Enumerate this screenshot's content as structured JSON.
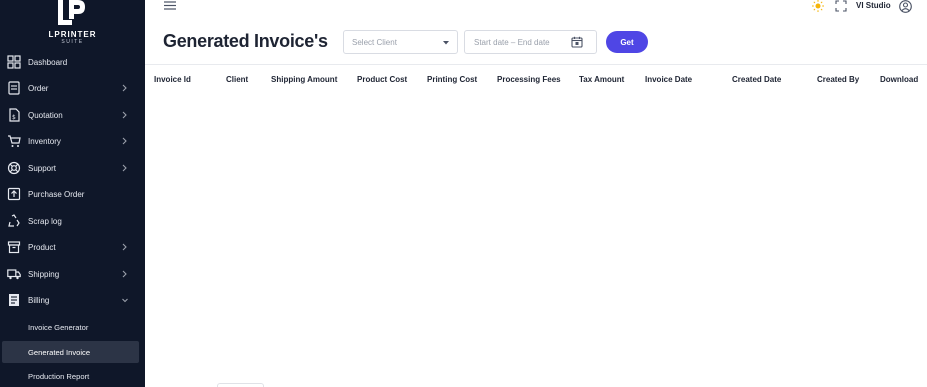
{
  "brand": {
    "title": "LPRINTER",
    "subtitle": "SUITE"
  },
  "sidebar": {
    "items": [
      {
        "label": "Dashboard",
        "icon": "dashboard-icon",
        "has_chevron": false
      },
      {
        "label": "Order",
        "icon": "order-icon",
        "has_chevron": true
      },
      {
        "label": "Quotation",
        "icon": "quotation-icon",
        "has_chevron": true
      },
      {
        "label": "Inventory",
        "icon": "cart-icon",
        "has_chevron": true
      },
      {
        "label": "Support",
        "icon": "support-icon",
        "has_chevron": true
      },
      {
        "label": "Purchase Order",
        "icon": "purchase-order-icon",
        "has_chevron": false
      },
      {
        "label": "Scrap log",
        "icon": "recycle-icon",
        "has_chevron": false
      },
      {
        "label": "Product",
        "icon": "archive-icon",
        "has_chevron": true
      },
      {
        "label": "Shipping",
        "icon": "truck-icon",
        "has_chevron": true
      },
      {
        "label": "Billing",
        "icon": "billing-icon",
        "has_chevron": true,
        "expanded": true
      }
    ],
    "billing_sub": [
      {
        "label": "Invoice Generator",
        "active": false
      },
      {
        "label": "Generated Invoice",
        "active": true
      },
      {
        "label": "Production Report",
        "active": false
      }
    ]
  },
  "topbar": {
    "user_name": "VI Studio"
  },
  "header": {
    "title": "Generated Invoice's",
    "client_placeholder": "Select Client",
    "date_placeholder": "Start date – End date",
    "get_label": "Get"
  },
  "table": {
    "columns": [
      "Invoice Id",
      "Client",
      "Shipping Amount",
      "Product Cost",
      "Printing Cost",
      "Processing Fees",
      "Tax Amount",
      "Invoice Date",
      "Created Date",
      "Created By",
      "Download"
    ],
    "rows": []
  },
  "colors": {
    "sidebar_bg": "#0f1729",
    "accent": "#4f46e5",
    "active_item_bg": "#2c3446"
  }
}
